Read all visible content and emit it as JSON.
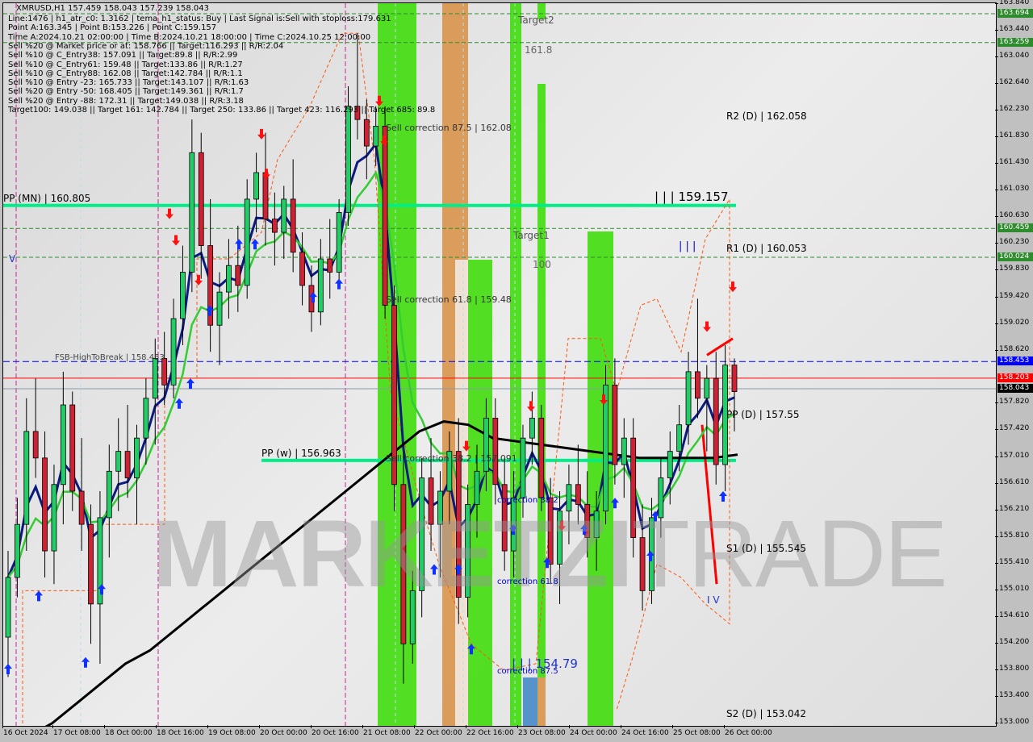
{
  "chart_data": {
    "type": "candlestick",
    "symbol": "XMRUSD",
    "timeframe": "H1",
    "title": "XMRUSD,H1  157.459 158.043 157.239 158.043",
    "ohlc_header": {
      "open": 157.459,
      "high": 158.043,
      "low": 157.239,
      "close": 158.043
    },
    "ylim": [
      153.0,
      163.84
    ],
    "y_ticks": [
      163.84,
      163.44,
      163.04,
      162.64,
      162.23,
      161.83,
      161.43,
      161.03,
      160.63,
      160.23,
      159.83,
      159.42,
      159.02,
      158.62,
      157.82,
      157.42,
      157.01,
      156.61,
      156.21,
      155.81,
      155.41,
      155.01,
      154.61,
      154.2,
      153.8,
      153.4,
      153.0
    ],
    "price_badges": [
      {
        "value": "163.694",
        "color": "#2e8b2e"
      },
      {
        "value": "163.259",
        "color": "#2e8b2e"
      },
      {
        "value": "160.459",
        "color": "#2e8b2e"
      },
      {
        "value": "160.024",
        "color": "#2e8b2e"
      },
      {
        "value": "158.453",
        "color": "#0000ff"
      },
      {
        "value": "158.203",
        "color": "#ff0000"
      },
      {
        "value": "158.043",
        "color": "#000000"
      }
    ],
    "x_ticks": [
      "16 Oct 2024",
      "17 Oct 08:00",
      "18 Oct 00:00",
      "18 Oct 16:00",
      "19 Oct 08:00",
      "20 Oct 00:00",
      "20 Oct 16:00",
      "21 Oct 08:00",
      "22 Oct 00:00",
      "22 Oct 16:00",
      "23 Oct 08:00",
      "24 Oct 00:00",
      "24 Oct 16:00",
      "25 Oct 08:00",
      "26 Oct 00:00"
    ],
    "horizontal_levels": [
      {
        "name": "PP (MN)",
        "value": 160.805,
        "label": "PP (MN) | 160.805",
        "color": "#00ee88"
      },
      {
        "name": "PP (w)",
        "value": 156.963,
        "label": "PP (w) | 156.963",
        "color": "#00ee88"
      },
      {
        "name": "FSB-HighToBreak",
        "value": 158.453,
        "label": "FSB-HighToBreak | 158.453",
        "color": "#0000ff"
      },
      {
        "name": "Last close",
        "value": 158.203,
        "color": "#ff0000"
      },
      {
        "name": "Bid",
        "value": 158.043,
        "color": "#8899aa"
      },
      {
        "name": "Target2 upper",
        "value": 163.694,
        "color": "#2e8b2e"
      },
      {
        "name": "Target2 lower",
        "value": 163.259,
        "color": "#2e8b2e"
      },
      {
        "name": "Target1 upper",
        "value": 160.459,
        "color": "#2e8b2e"
      },
      {
        "name": "Target1 lower",
        "value": 160.024,
        "color": "#2e8b2e"
      }
    ],
    "pivot_labels": [
      {
        "label": "R2 (D) | 162.058",
        "value": 162.058
      },
      {
        "label": "R1 (D) | 160.053",
        "value": 160.053
      },
      {
        "label": "PP (D) | 157.55",
        "value": 157.55
      },
      {
        "label": "S1 (D) | 155.545",
        "value": 155.545
      },
      {
        "label": "S2 (D) | 153.042",
        "value": 153.042
      }
    ],
    "annotations": [
      {
        "text": "| | | 159.157",
        "value": 159.157
      },
      {
        "text": "| | |",
        "value": 160.1
      },
      {
        "text": "| | | 154.79",
        "value": 154.79
      },
      {
        "text": "Sell correction 87.5 | 162.08",
        "value": 162.08
      },
      {
        "text": "Sell correction 61.8 | 159.48",
        "value": 159.48
      },
      {
        "text": "Sell correction 38.2 | 157.091",
        "value": 157.091
      },
      {
        "text": "correction 38.2",
        "value": 156.3
      },
      {
        "text": "correction 61.8",
        "value": 155.1
      },
      {
        "text": "correction 87.5",
        "value": 153.8
      },
      {
        "text": "Target2",
        "value": 163.6
      },
      {
        "text": "161.8",
        "value": 163.0
      },
      {
        "text": "Target1",
        "value": 160.3
      },
      {
        "text": "100",
        "value": 159.9
      },
      {
        "text": "V",
        "value": 160.0
      },
      {
        "text": "I V",
        "value": 154.8
      }
    ],
    "candles_approx": [
      [
        154.3,
        155.6,
        153.7,
        155.2
      ],
      [
        155.2,
        156.4,
        154.9,
        156.0
      ],
      [
        156.0,
        157.9,
        155.6,
        157.4
      ],
      [
        157.4,
        158.2,
        156.7,
        157.0
      ],
      [
        157.0,
        157.4,
        155.2,
        155.6
      ],
      [
        155.6,
        156.9,
        155.1,
        156.6
      ],
      [
        156.6,
        158.3,
        156.0,
        157.8
      ],
      [
        157.8,
        158.0,
        156.2,
        156.5
      ],
      [
        156.5,
        157.3,
        155.6,
        156.0
      ],
      [
        156.0,
        156.3,
        154.2,
        154.8
      ],
      [
        154.8,
        156.5,
        153.9,
        156.1
      ],
      [
        156.1,
        157.2,
        155.5,
        156.8
      ],
      [
        156.8,
        157.6,
        156.2,
        157.1
      ],
      [
        157.1,
        157.8,
        156.4,
        156.7
      ],
      [
        156.7,
        157.5,
        156.0,
        157.3
      ],
      [
        157.3,
        158.2,
        156.9,
        157.9
      ],
      [
        157.9,
        158.8,
        157.2,
        158.5
      ],
      [
        158.5,
        158.9,
        157.8,
        158.1
      ],
      [
        158.1,
        159.4,
        157.9,
        159.1
      ],
      [
        159.1,
        160.2,
        158.7,
        159.8
      ],
      [
        159.8,
        162.1,
        159.5,
        161.6
      ],
      [
        161.6,
        161.9,
        159.7,
        160.2
      ],
      [
        160.2,
        160.9,
        158.6,
        159.0
      ],
      [
        159.0,
        159.8,
        158.4,
        159.5
      ],
      [
        159.5,
        160.3,
        159.1,
        159.9
      ],
      [
        159.9,
        160.5,
        159.2,
        159.6
      ],
      [
        159.6,
        161.2,
        159.4,
        160.9
      ],
      [
        160.9,
        161.6,
        160.4,
        161.3
      ],
      [
        161.3,
        161.9,
        160.2,
        160.6
      ],
      [
        160.6,
        161.0,
        159.9,
        160.4
      ],
      [
        160.4,
        161.1,
        160.0,
        160.9
      ],
      [
        160.9,
        161.5,
        159.8,
        160.1
      ],
      [
        160.1,
        160.4,
        159.3,
        159.6
      ],
      [
        159.6,
        159.9,
        158.9,
        159.2
      ],
      [
        159.2,
        160.3,
        159.0,
        160.0
      ],
      [
        160.0,
        160.6,
        159.4,
        159.8
      ],
      [
        159.8,
        160.9,
        159.6,
        160.7
      ],
      [
        160.7,
        162.6,
        160.5,
        162.3
      ],
      [
        162.3,
        163.4,
        161.8,
        162.1
      ],
      [
        162.1,
        162.4,
        161.2,
        161.7
      ],
      [
        161.7,
        162.3,
        161.4,
        162.0
      ],
      [
        162.0,
        162.3,
        159.1,
        159.3
      ],
      [
        159.3,
        159.6,
        156.2,
        156.6
      ],
      [
        156.6,
        157.1,
        153.6,
        154.2
      ],
      [
        154.2,
        155.3,
        153.9,
        155.0
      ],
      [
        155.0,
        157.0,
        154.6,
        156.7
      ],
      [
        156.7,
        157.3,
        155.6,
        156.0
      ],
      [
        156.0,
        156.8,
        155.2,
        156.5
      ],
      [
        156.5,
        157.4,
        156.0,
        157.1
      ],
      [
        157.1,
        157.6,
        154.5,
        154.9
      ],
      [
        154.9,
        156.6,
        154.6,
        156.3
      ],
      [
        156.3,
        157.2,
        155.8,
        156.8
      ],
      [
        156.8,
        157.9,
        156.5,
        157.6
      ],
      [
        157.6,
        157.9,
        156.3,
        156.6
      ],
      [
        156.6,
        157.0,
        155.3,
        155.6
      ],
      [
        155.6,
        156.8,
        155.2,
        156.4
      ],
      [
        156.4,
        157.5,
        156.1,
        157.3
      ],
      [
        157.3,
        158.0,
        156.9,
        157.6
      ],
      [
        157.6,
        157.8,
        156.2,
        156.4
      ],
      [
        156.4,
        156.7,
        155.1,
        155.4
      ],
      [
        155.4,
        156.5,
        154.8,
        156.2
      ],
      [
        156.2,
        156.9,
        155.7,
        156.6
      ],
      [
        156.6,
        157.2,
        156.0,
        156.3
      ],
      [
        156.3,
        156.8,
        155.5,
        155.8
      ],
      [
        155.8,
        156.5,
        155.3,
        156.2
      ],
      [
        156.2,
        158.4,
        156.0,
        158.1
      ],
      [
        158.1,
        158.5,
        156.6,
        156.9
      ],
      [
        156.9,
        157.6,
        156.4,
        157.3
      ],
      [
        157.3,
        157.6,
        155.5,
        155.8
      ],
      [
        155.8,
        156.3,
        154.7,
        155.0
      ],
      [
        155.0,
        156.4,
        154.8,
        156.1
      ],
      [
        156.1,
        157.0,
        155.8,
        156.7
      ],
      [
        156.7,
        157.4,
        156.3,
        157.1
      ],
      [
        157.1,
        157.8,
        156.8,
        157.5
      ],
      [
        157.5,
        158.6,
        157.2,
        158.3
      ],
      [
        158.3,
        159.4,
        157.6,
        157.9
      ],
      [
        157.9,
        158.4,
        157.1,
        158.2
      ],
      [
        158.2,
        158.6,
        156.6,
        156.9
      ],
      [
        156.9,
        158.7,
        156.5,
        158.4
      ],
      [
        158.4,
        158.5,
        157.4,
        158.0
      ]
    ]
  },
  "watermark": {
    "bold": "MARKETZI",
    "thin": "TRADE"
  },
  "info_panel": {
    "lines": [
      "Line:1476 | h1_atr_c0: 1.3162 | tema_h1_status: Buy | Last Signal is:Sell with stoploss:179.631",
      "Point A:163.345 | Point B:153.226 | Point C:159.157",
      "Time A:2024.10.21 02:00:00 | Time B:2024.10.21 18:00:00 | Time C:2024.10.25 12:00:00",
      "Sell %20 @ Market price or at: 158.766 || Target:116.293 || R/R:2.04",
      "Sell %10 @ C_Entry38: 157.091 || Target:89.8 || R/R:2.99",
      "Sell %10 @ C_Entry61: 159.48 || Target:133.86 || R/R:1.27",
      "Sell %10 @ C_Entry88: 162.08 || Target:142.784 || R/R:1.1",
      "Sell %10 @ Entry -23: 165.733 || Target:143.107 || R/R:1.63",
      "Sell %20 @ Entry -50: 168.405 || Target:149.361 || R/R:1.7",
      "Sell %20 @ Entry -88: 172.31 || Target:149.038 || R/R:3.18",
      "Target100: 149.038 || Target 161: 142.784 || Target 250: 133.86 || Target 423: 116.293 || Target 685: 89.8"
    ]
  },
  "colors": {
    "bull_candle": "#22cc66",
    "bear_candle": "#cc2233",
    "zone_green": "#44dd11",
    "zone_orange": "#d9964f",
    "zone_blue": "#4a8cc9",
    "ma_navy": "#0a1a80",
    "ma_green": "#33cc33",
    "ma_black": "#000000",
    "level_green": "#00ee88",
    "dashed_orange": "#ff5511",
    "magenta_vline": "#cc2299"
  }
}
